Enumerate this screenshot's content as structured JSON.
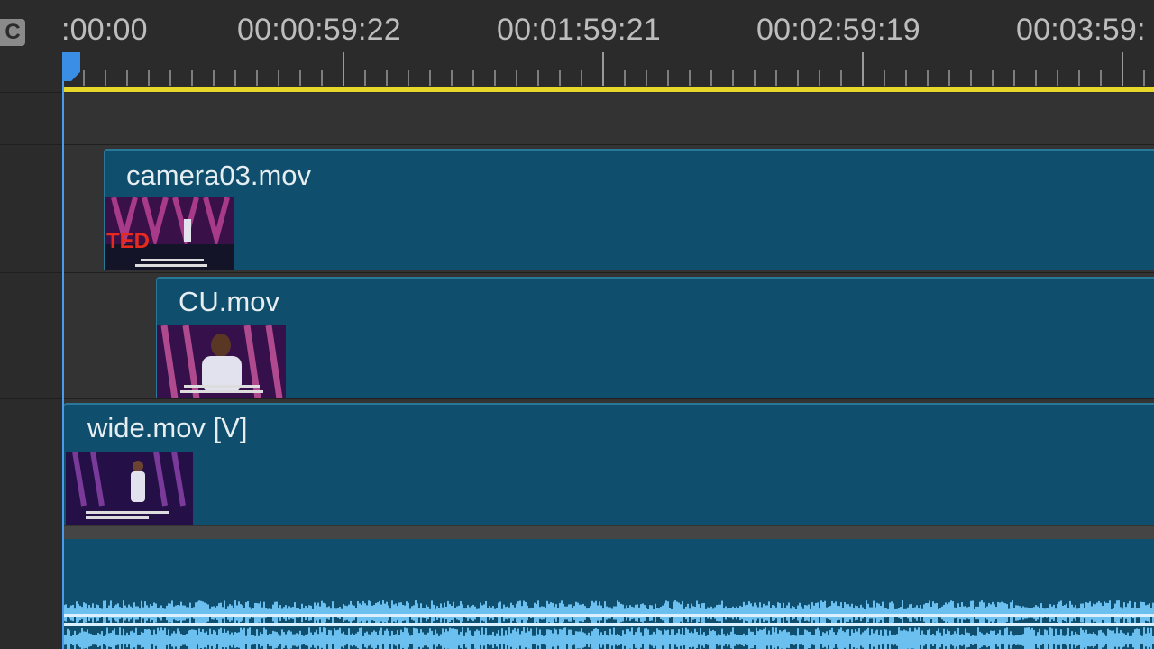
{
  "app": {
    "panel_icon_letter": "C"
  },
  "ruler": {
    "timecodes": [
      ":00:00",
      "00:00:59:22",
      "00:01:59:21",
      "00:02:59:19",
      "00:03:59:"
    ]
  },
  "clips": {
    "camera03": {
      "name": "camera03.mov",
      "thumb_caption": "TED"
    },
    "cu": {
      "name": "CU.mov"
    },
    "wide": {
      "name": "wide.mov [V]"
    }
  },
  "colors": {
    "clip_fill": "#0f4e6c",
    "clip_border": "#2a7898",
    "work_area": "#e6d92c",
    "playhead": "#3a8ee6",
    "waveform": "#6cc0f0",
    "ted_red": "#e62b1e"
  },
  "icons": {
    "playhead": "playhead-marker-icon",
    "panel": "c-panel-icon"
  }
}
